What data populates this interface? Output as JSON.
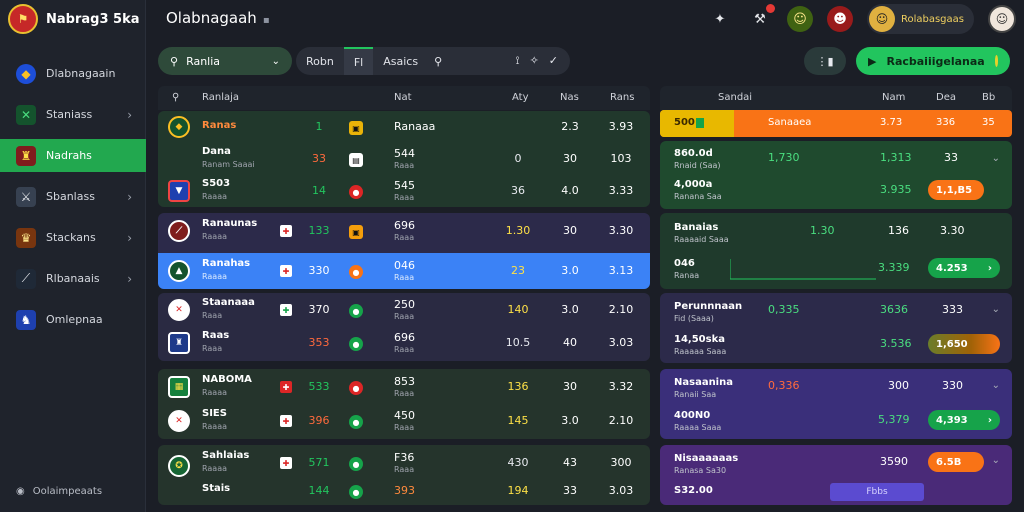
{
  "brand": {
    "name": "Nabrag3 5ka"
  },
  "sidebar": {
    "items": [
      {
        "label": "Dlabnagaain",
        "icon": "shield-icon",
        "chevron": false,
        "active": false
      },
      {
        "label": "Staniass",
        "icon": "flag-icon",
        "chevron": true,
        "active": false
      },
      {
        "label": "Nadrahs",
        "icon": "trophy-icon",
        "chevron": false,
        "active": true
      },
      {
        "label": "Sbanlass",
        "icon": "sword-icon",
        "chevron": true,
        "active": false
      },
      {
        "label": "Stackans",
        "icon": "crest-icon",
        "chevron": true,
        "active": false
      },
      {
        "label": "Rlbanaais",
        "icon": "blade-icon",
        "chevron": true,
        "active": false
      },
      {
        "label": "Omlepnaa",
        "icon": "badge-icon",
        "chevron": false,
        "active": false
      }
    ],
    "footer": "Oolaimpeaats"
  },
  "topbar": {
    "title": "Olabnagaah",
    "user": "Rolabasgaas"
  },
  "filter": {
    "select_label": "Ranlia",
    "tabs": [
      "Robn",
      "Fl",
      "Asaics"
    ]
  },
  "cta": {
    "label": "Racbaiiigelanaa"
  },
  "left_table": {
    "headers": {
      "col1": "Ranlaja",
      "col2": "Nat",
      "col3": "Aty",
      "col4": "Nas",
      "col5": "Rans"
    },
    "rows": [
      {
        "name": "Ranas",
        "sub": "",
        "c1": "1",
        "c3": "Ranaaa",
        "c3s": "",
        "c4": "",
        "c5": "2.3",
        "c6": "3.93",
        "c1color": "#22c55e"
      },
      {
        "name": "Dana",
        "sub": "Ranam Saaai",
        "c1": "33",
        "c3": "544",
        "c3s": "Raaa",
        "c4": "0",
        "c5": "30",
        "c6": "103",
        "c1color": "#ff6a3d"
      },
      {
        "name": "S503",
        "sub": "Raaaa",
        "c1": "14",
        "c3": "545",
        "c3s": "Raaa",
        "c4": "36",
        "c5": "4.0",
        "c6": "3.33",
        "c1color": "#22c55e"
      },
      {
        "name": "Ranaunas",
        "sub": "Raaaa",
        "c1": "133",
        "c3": "696",
        "c3s": "Raaa",
        "c4": "1.30",
        "c5": "30",
        "c6": "3.30",
        "c1color": "#22c55e"
      },
      {
        "name": "Ranahas",
        "sub": "Raaaa",
        "c1": "330",
        "c3": "046",
        "c3s": "Raaa",
        "c4": "23",
        "c5": "3.0",
        "c6": "3.13",
        "c1color": "#22c55e"
      },
      {
        "name": "Staanaaa",
        "sub": "Raaa",
        "c1": "370",
        "c3": "250",
        "c3s": "Raaa",
        "c4": "140",
        "c5": "3.0",
        "c6": "2.10",
        "c1color": "#ffffff"
      },
      {
        "name": "Raas",
        "sub": "Raaa",
        "c1": "353",
        "c3": "696",
        "c3s": "Raaa",
        "c4": "10.5",
        "c5": "40",
        "c6": "3.03",
        "c1color": "#ff6a3d"
      },
      {
        "name": "NABOMA",
        "sub": "Raaaa",
        "c1": "533",
        "c3": "853",
        "c3s": "Raaa",
        "c4": "136",
        "c5": "30",
        "c6": "3.32",
        "c1color": "#22c55e"
      },
      {
        "name": "SIES",
        "sub": "Raaaa",
        "c1": "396",
        "c3": "450",
        "c3s": "Raaa",
        "c4": "145",
        "c5": "3.0",
        "c6": "2.10",
        "c1color": "#ff6a3d"
      },
      {
        "name": "Sahlaias",
        "sub": "Raaaa",
        "c1": "571",
        "c3": "F36",
        "c3s": "Raaa",
        "c4": "430",
        "c5": "43",
        "c6": "300",
        "c1color": "#22c55e"
      },
      {
        "name": "Stais",
        "sub": "",
        "c1": "144",
        "c3": "393",
        "c3s": "",
        "c4": "194",
        "c5": "33",
        "c6": "3.03",
        "c1color": "#22c55e"
      }
    ]
  },
  "right_table": {
    "headers": {
      "col1": "Sandai",
      "col2": "Nam",
      "col3": "Dea",
      "col4": "Bb"
    },
    "banner": {
      "left": "500",
      "mid": "Sanaaea",
      "v1": "3.73",
      "v2": "336",
      "v3": "35"
    },
    "rows": [
      {
        "name": "860.0d",
        "sub": "Rnaid (Saa)",
        "v1": "1,730",
        "v2": "1,313",
        "v3": "33"
      },
      {
        "name": "4,000a",
        "sub": "Ranana Saa",
        "v2": "3.935",
        "pill": "1,1,B5"
      },
      {
        "name": "Banaias",
        "sub": "Raaaaid Saaa",
        "v1": "1.30",
        "v2": "136",
        "v3": "3.30"
      },
      {
        "name": "046",
        "sub": "Ranaa",
        "v2": "3.339",
        "pill": "4.253"
      },
      {
        "name": "Perunnnaan",
        "sub": "Fid (Saaa)",
        "v1": "0,335",
        "v2": "3636",
        "v3": "333"
      },
      {
        "name": "14,50ska",
        "sub": "Raaaaa Saaa",
        "v2": "3.536",
        "pill": "1,650"
      },
      {
        "name": "Nasaanina",
        "sub": "Ranaii Saa",
        "v1": "0,336",
        "v2": "300",
        "v3": "330"
      },
      {
        "name": "400N0",
        "sub": "Raaaa Saaa",
        "v2": "5,379",
        "pill": "4,393"
      },
      {
        "name": "Nisaaaaaas",
        "sub": "Ranasa Sa30",
        "v2": "3590",
        "pill": "6.5B"
      },
      {
        "name": "S32.00",
        "sub": "",
        "btn": "Fbbs"
      }
    ]
  }
}
